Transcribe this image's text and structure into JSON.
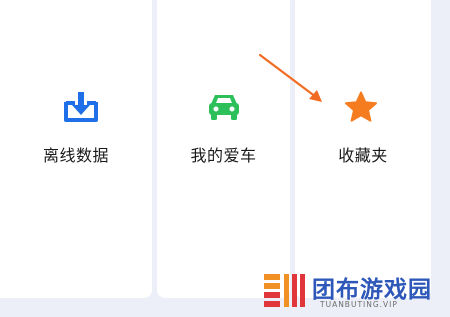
{
  "tiles": [
    {
      "label": "离线数据",
      "icon": "download-box-icon",
      "color": "#1f6fe8"
    },
    {
      "label": "我的爱车",
      "icon": "car-icon",
      "color": "#2cbf5a"
    },
    {
      "label": "收藏夹",
      "icon": "star-icon",
      "color": "#f57c1f"
    }
  ],
  "annotation": {
    "arrow_color": "#f26b22"
  },
  "watermark": {
    "title": "团布游戏园",
    "subtitle": "TUANBUTING.VIP"
  }
}
